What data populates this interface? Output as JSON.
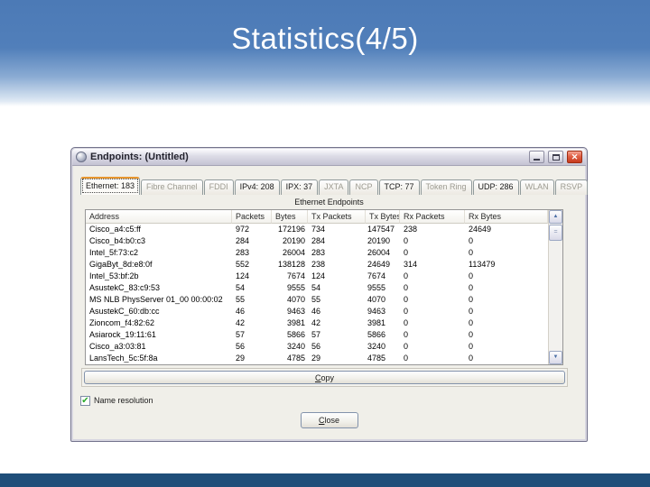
{
  "slide": {
    "title": "Statistics(4/5)"
  },
  "colors": {
    "slide_header_blue": "#4c7ab6",
    "footer_bar_navy": "#1f4e79",
    "active_tab_highlight_orange": "#e8962e",
    "close_button_red": "#c63a1d",
    "checkbox_check_green": "#2bab2b"
  },
  "icons": {
    "window_icon": "app-sphere",
    "minimize": "minimize-bar",
    "maximize": "maximize-square",
    "close": "✕",
    "scroll_up": "▲",
    "scroll_down": "▼",
    "scroll_thumb_grip": "=",
    "checkbox_check": "✔"
  },
  "dialog": {
    "title": "Endpoints: (Untitled)",
    "subtitle": "Ethernet Endpoints",
    "tabs": [
      {
        "label": "Ethernet: 183",
        "active": true,
        "enabled": true
      },
      {
        "label": "Fibre Channel",
        "active": false,
        "enabled": false
      },
      {
        "label": "FDDI",
        "active": false,
        "enabled": false
      },
      {
        "label": "IPv4: 208",
        "active": false,
        "enabled": true
      },
      {
        "label": "IPX: 37",
        "active": false,
        "enabled": true
      },
      {
        "label": "JXTA",
        "active": false,
        "enabled": false
      },
      {
        "label": "NCP",
        "active": false,
        "enabled": false
      },
      {
        "label": "TCP: 77",
        "active": false,
        "enabled": true
      },
      {
        "label": "Token Ring",
        "active": false,
        "enabled": false
      },
      {
        "label": "UDP: 286",
        "active": false,
        "enabled": true
      },
      {
        "label": "WLAN",
        "active": false,
        "enabled": false
      },
      {
        "label": "RSVP",
        "active": false,
        "enabled": false
      }
    ],
    "table": {
      "columns": [
        "Address",
        "Packets",
        "Bytes",
        "Tx Packets",
        "Tx Bytes",
        "Rx Packets",
        "Rx Bytes"
      ],
      "rows": [
        [
          "Cisco_a4:c5:ff",
          "972",
          "172196",
          "734",
          "147547",
          "238",
          "24649"
        ],
        [
          "Cisco_b4:b0:c3",
          "284",
          "20190",
          "284",
          "20190",
          "0",
          "0"
        ],
        [
          "Intel_5f:73:c2",
          "283",
          "26004",
          "283",
          "26004",
          "0",
          "0"
        ],
        [
          "GigaByt_8d:e8:0f",
          "552",
          "138128",
          "238",
          "24649",
          "314",
          "113479"
        ],
        [
          "Intel_53:bf:2b",
          "124",
          "7674",
          "124",
          "7674",
          "0",
          "0"
        ],
        [
          "AsustekC_83:c9:53",
          "54",
          "9555",
          "54",
          "9555",
          "0",
          "0"
        ],
        [
          "MS NLB PhysServer 01_00 00:00:02",
          "55",
          "4070",
          "55",
          "4070",
          "0",
          "0"
        ],
        [
          "AsustekC_60:db:cc",
          "46",
          "9463",
          "46",
          "9463",
          "0",
          "0"
        ],
        [
          "Zioncom_f4:82:62",
          "42",
          "3981",
          "42",
          "3981",
          "0",
          "0"
        ],
        [
          "Asiarock_19:11:61",
          "57",
          "5866",
          "57",
          "5866",
          "0",
          "0"
        ],
        [
          "Cisco_a3:03:81",
          "56",
          "3240",
          "56",
          "3240",
          "0",
          "0"
        ],
        [
          "LansTech_5c:5f:8a",
          "29",
          "4785",
          "29",
          "4785",
          "0",
          "0"
        ]
      ]
    },
    "copy_button_label": "Copy",
    "name_resolution_label": "Name resolution",
    "name_resolution_checked": true,
    "close_button_label": "Close"
  }
}
